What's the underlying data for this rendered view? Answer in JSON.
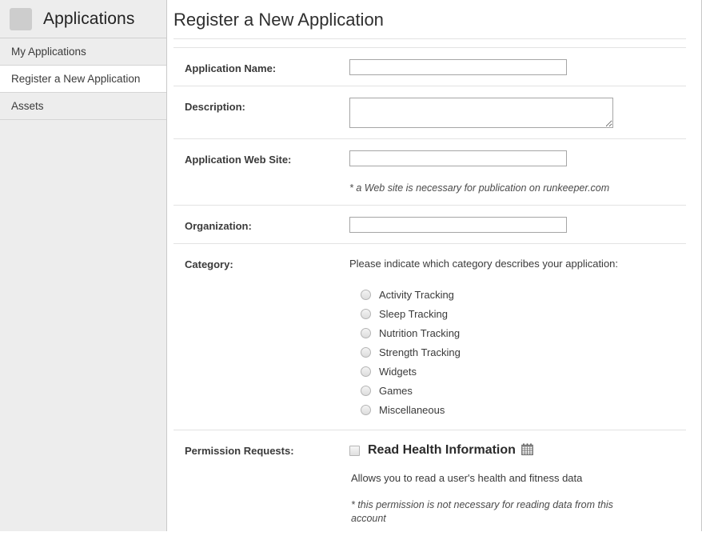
{
  "sidebar": {
    "header": {
      "title": "Applications",
      "icon": "app-placeholder-icon"
    },
    "items": [
      {
        "label": "My Applications",
        "active": false
      },
      {
        "label": "Register a New Application",
        "active": true
      },
      {
        "label": "Assets",
        "active": false
      }
    ]
  },
  "main": {
    "title": "Register a New Application",
    "fields": {
      "application_name": {
        "label": "Application Name:",
        "value": "",
        "placeholder": ""
      },
      "description": {
        "label": "Description:",
        "value": "",
        "placeholder": ""
      },
      "application_web_site": {
        "label": "Application Web Site:",
        "value": "",
        "placeholder": "",
        "note": "* a Web site is necessary for publication on runkeeper.com"
      },
      "organization": {
        "label": "Organization:",
        "value": "",
        "placeholder": ""
      },
      "category": {
        "label": "Category:",
        "prompt": "Please indicate which category describes your application:",
        "options": [
          {
            "label": "Activity Tracking",
            "selected": false
          },
          {
            "label": "Sleep Tracking",
            "selected": false
          },
          {
            "label": "Nutrition Tracking",
            "selected": false
          },
          {
            "label": "Strength Tracking",
            "selected": false
          },
          {
            "label": "Widgets",
            "selected": false
          },
          {
            "label": "Games",
            "selected": false
          },
          {
            "label": "Miscellaneous",
            "selected": false
          }
        ]
      },
      "permission_requests": {
        "label": "Permission Requests:",
        "permission_title": "Read Health Information",
        "permission_icon": "calendar-icon",
        "permission_icon_glyph": "🗓",
        "checked": false,
        "description": "Allows you to read a user's health and fitness data",
        "note": "* this permission is not necessary for reading data from this account"
      }
    }
  },
  "colors": {
    "sidebar_bg": "#ededed",
    "sidebar_border": "#c9c9c9",
    "active_item_bg": "#ffffff",
    "divider": "#e3e3e3",
    "input_border": "#a6a6a6",
    "text": "#3a3a3a"
  }
}
